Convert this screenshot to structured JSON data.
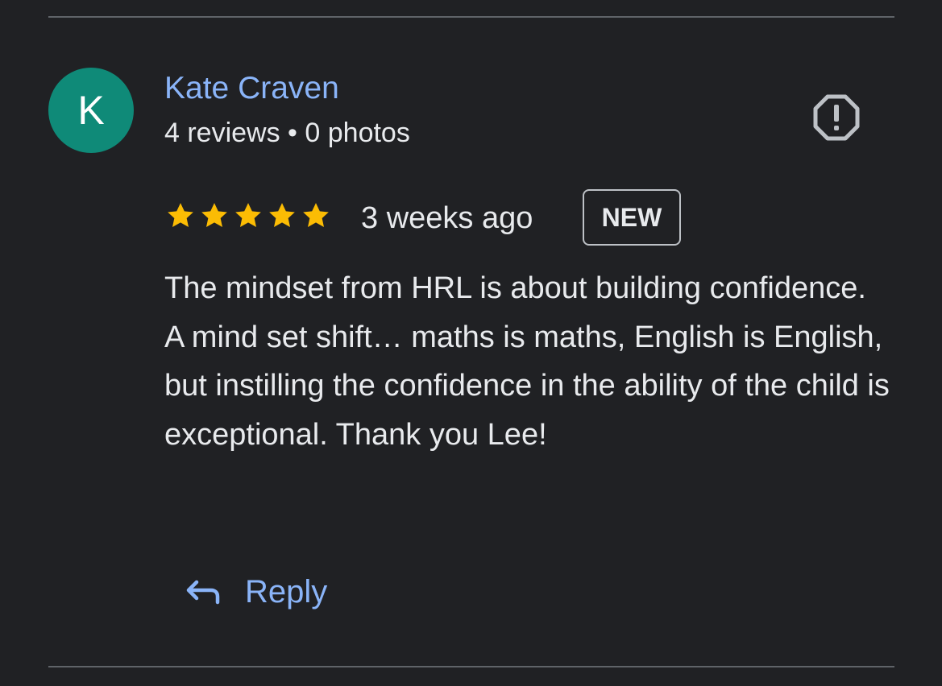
{
  "review": {
    "author": {
      "initial": "K",
      "name": "Kate Craven",
      "meta": "4 reviews • 0 photos",
      "avatar_color": "#0f8a78"
    },
    "rating": 5,
    "max_rating": 5,
    "star_color": "#fbbc04",
    "time_ago": "3 weeks ago",
    "badge": "NEW",
    "text": "The mindset from HRL is about building confidence. A mind set shift… maths is maths, English is English, but instilling the confidence in the ability of the child is exceptional. Thank you Lee!",
    "report_icon": "report-flag-icon"
  },
  "actions": {
    "reply_label": "Reply",
    "reply_icon": "reply-arrow-icon"
  },
  "colors": {
    "background": "#202124",
    "link": "#8ab4f8",
    "text": "#e8eaed"
  }
}
